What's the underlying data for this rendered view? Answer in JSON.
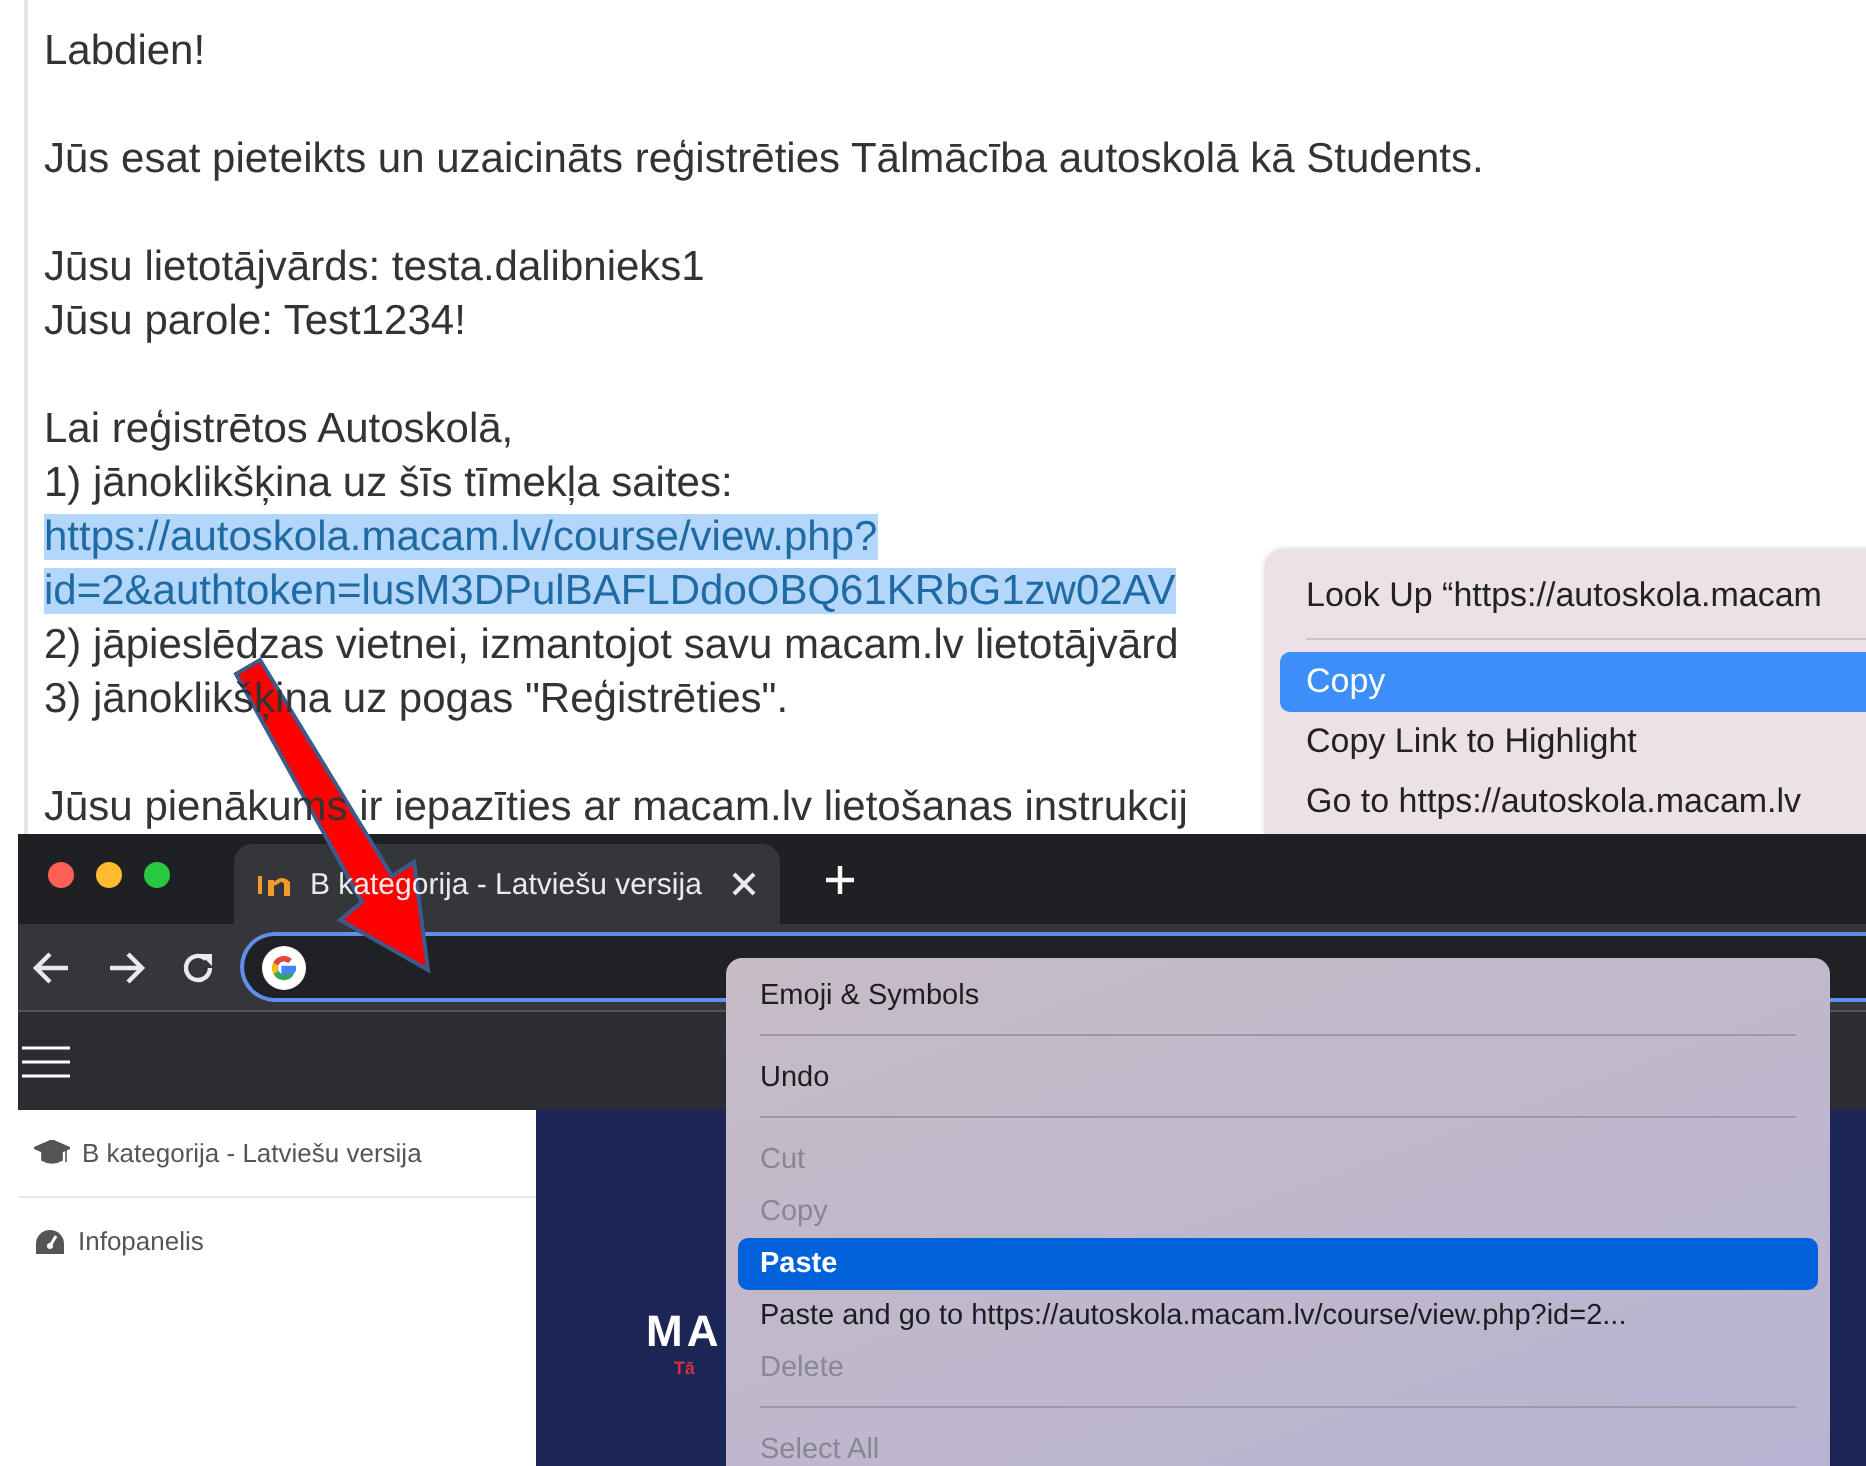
{
  "email": {
    "paragraphs": [
      [
        {
          "kind": "text",
          "text": "Labdien!"
        }
      ],
      [
        {
          "kind": "text",
          "text": "Jūs esat pieteikts un uzaicināts reģistrēties Tālmācība autoskolā kā Students."
        }
      ],
      [
        {
          "kind": "text",
          "text": "Jūsu lietotājvārds: testa.dalibnieks1"
        },
        {
          "kind": "text",
          "text": "Jūsu parole: Test1234!"
        }
      ],
      [
        {
          "kind": "text",
          "text": "Lai reģistrētos Autoskolā,"
        },
        {
          "kind": "text",
          "text": "1) jānoklikšķina uz šīs tīmekļa saites:"
        },
        {
          "kind": "link",
          "text": "https://autoskola.macam.lv/course/view.php?",
          "selected": true
        },
        {
          "kind": "link",
          "text": "id=2&authtoken=lusM3DPulBAFLDdoOBQ61KRbG1zw02AV",
          "selected": true
        },
        {
          "kind": "text",
          "text": "2) jāpieslēdzas vietnei, izmantojot savu macam.lv lietotājvārd"
        },
        {
          "kind": "text",
          "text": "3) jānoklikšķina uz pogas \"Reģistrēties\"."
        }
      ],
      [
        {
          "kind": "text",
          "text": "Jūsu pienākums ir iepazīties ar macam.lv lietošanas instrukcij"
        }
      ]
    ]
  },
  "email_menu": {
    "items": [
      {
        "kind": "item",
        "label": "Look Up “https://autoskola.macam",
        "selected": false
      },
      {
        "kind": "separator"
      },
      {
        "kind": "item",
        "label": "Copy",
        "selected": true
      },
      {
        "kind": "item",
        "label": "Copy Link to Highlight",
        "selected": false
      },
      {
        "kind": "item",
        "label": "Go to https://autoskola.macam.lv",
        "selected": false
      }
    ]
  },
  "browser": {
    "tab": {
      "title": "B kategorija - Latviešu versija"
    },
    "sidebar": {
      "items": [
        {
          "kind": "course",
          "label": "B kategorija - Latviešu versija"
        },
        {
          "kind": "dashboard",
          "label": "Infopanelis"
        }
      ]
    },
    "banner": {
      "logo": "MA",
      "tagline": "Tā"
    },
    "context_menu": {
      "items": [
        {
          "kind": "item",
          "label": "Emoji & Symbols",
          "selected": false,
          "disabled": false
        },
        {
          "kind": "separator"
        },
        {
          "kind": "item",
          "label": "Undo",
          "selected": false,
          "disabled": false
        },
        {
          "kind": "separator"
        },
        {
          "kind": "item",
          "label": "Cut",
          "selected": false,
          "disabled": true
        },
        {
          "kind": "item",
          "label": "Copy",
          "selected": false,
          "disabled": true
        },
        {
          "kind": "item",
          "label": "Paste",
          "selected": true,
          "disabled": false
        },
        {
          "kind": "item",
          "label": "Paste and go to https://autoskola.macam.lv/course/view.php?id=2...",
          "selected": false,
          "disabled": false
        },
        {
          "kind": "item",
          "label": "Delete",
          "selected": false,
          "disabled": true
        },
        {
          "kind": "separator"
        },
        {
          "kind": "item",
          "label": "Select All",
          "selected": false,
          "disabled": true
        }
      ]
    }
  }
}
